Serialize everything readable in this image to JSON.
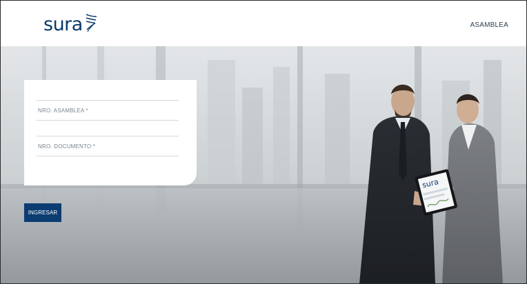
{
  "header": {
    "logo_text": "sura",
    "nav_link": "ASAMBLEA"
  },
  "form": {
    "field_assembly_placeholder": "NRO. ASAMBLEA *",
    "field_document_placeholder": "NRO. DOCUMENTO *",
    "submit_label": "INGRESAR"
  },
  "tablet": {
    "screen_logo": "sura"
  },
  "colors": {
    "brand": "#0b3c72",
    "logo": "#0a3a6b"
  },
  "icons": {
    "logo_mark": "wing-icon"
  }
}
